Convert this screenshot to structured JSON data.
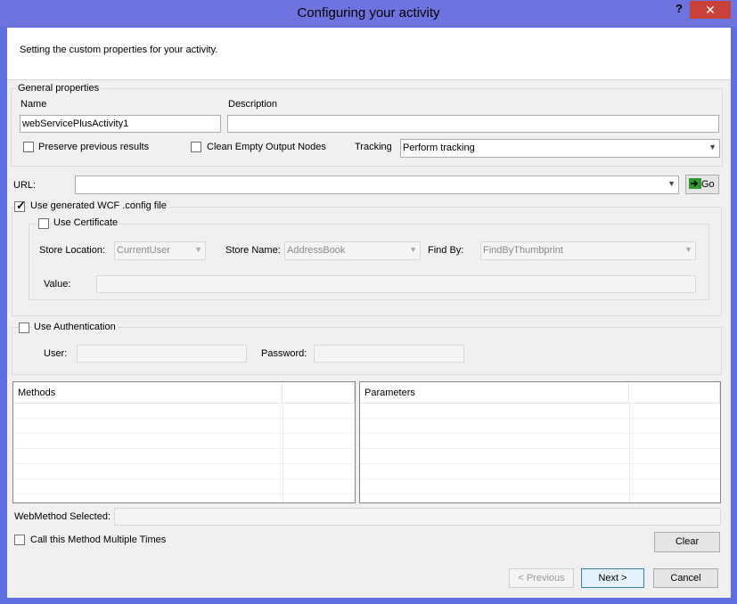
{
  "window": {
    "title": "Configuring your activity",
    "help_label": "?",
    "close_label": "✕"
  },
  "header": {
    "description": "Setting the custom properties for your activity."
  },
  "general": {
    "legend": "General properties",
    "name_label": "Name",
    "name_value": "webServicePlusActivity1",
    "description_label": "Description",
    "description_value": "",
    "preserve_label": "Preserve previous results",
    "preserve_checked": false,
    "clean_label": "Clean Empty Output Nodes",
    "clean_checked": false,
    "tracking_label": "Tracking",
    "tracking_value": "Perform tracking"
  },
  "url": {
    "label": "URL:",
    "value": "",
    "go_label": "Go"
  },
  "wcf": {
    "label": "Use generated WCF .config file",
    "checked": true,
    "certificate": {
      "label": "Use Certificate",
      "checked": false,
      "store_location_label": "Store Location:",
      "store_location_value": "CurrentUser",
      "store_name_label": "Store Name:",
      "store_name_value": "AddressBook",
      "find_by_label": "Find By:",
      "find_by_value": "FindByThumbprint",
      "value_label": "Value:",
      "value_value": ""
    }
  },
  "auth": {
    "label": "Use Authentication",
    "checked": false,
    "user_label": "User:",
    "user_value": "",
    "password_label": "Password:",
    "password_value": ""
  },
  "methods": {
    "header": "Methods"
  },
  "parameters": {
    "header": "Parameters"
  },
  "webmethod": {
    "label": "WebMethod Selected:",
    "value": ""
  },
  "multiple": {
    "label": "Call this Method Multiple Times",
    "checked": false
  },
  "buttons": {
    "clear": "Clear",
    "previous": "< Previous",
    "next": "Next >",
    "cancel": "Cancel"
  },
  "colors": {
    "title_bar": "#6f73df",
    "close_button": "#c8423a",
    "go_icon": "#2e9a2e"
  },
  "icons": {
    "go": "green-arrow-icon",
    "dropdown": "chevron-down-icon"
  }
}
